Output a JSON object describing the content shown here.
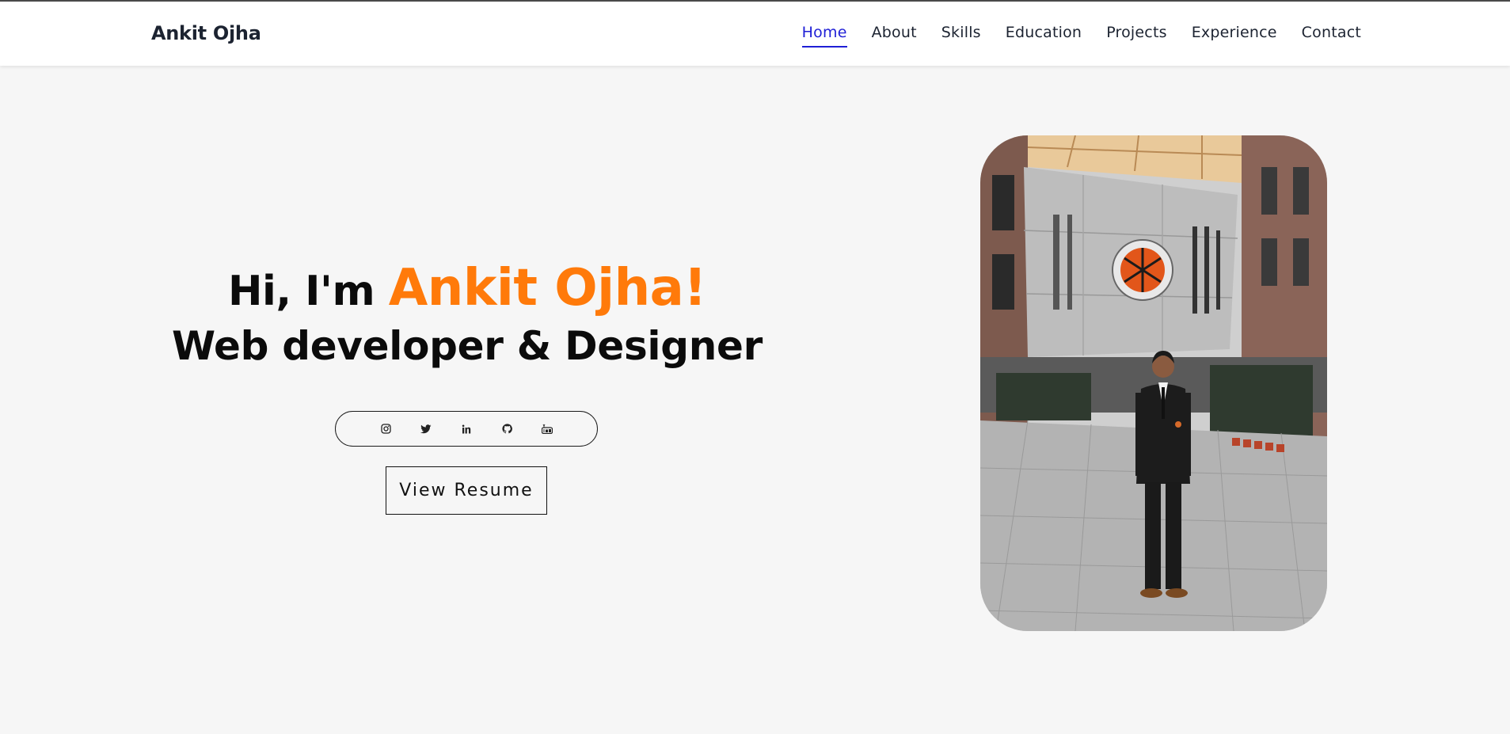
{
  "brand": "Ankit Ojha",
  "nav": [
    {
      "label": "Home",
      "active": true
    },
    {
      "label": "About"
    },
    {
      "label": "Skills"
    },
    {
      "label": "Education"
    },
    {
      "label": "Projects"
    },
    {
      "label": "Experience"
    },
    {
      "label": "Contact"
    }
  ],
  "hero": {
    "greeting": "Hi, I'm",
    "name": "Ankit Ojha!",
    "tagline": "Web developer & Designer",
    "resume_label": "View Resume"
  },
  "socials": [
    "instagram-icon",
    "twitter-icon",
    "linkedin-icon",
    "github-icon",
    "youtube-icon"
  ],
  "colors": {
    "accent": "#ff7a0a",
    "nav_active": "#1f1fd6",
    "background": "#f6f6f6",
    "text": "#0b0b0b"
  }
}
